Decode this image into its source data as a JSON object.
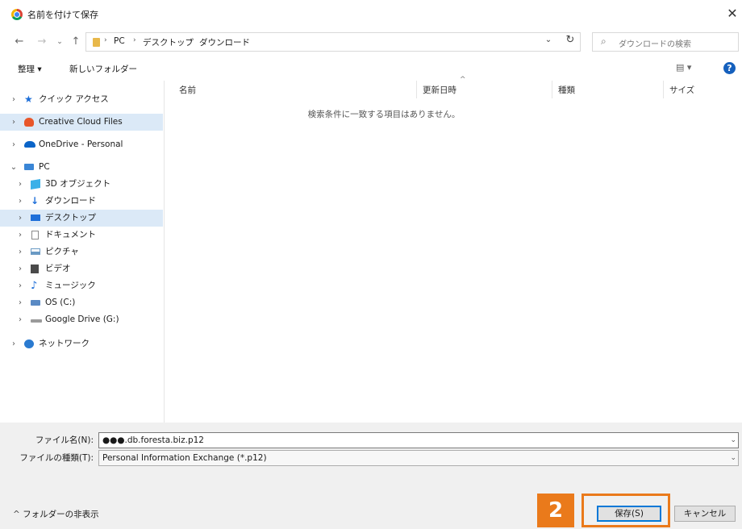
{
  "window": {
    "title": "名前を付けて保存",
    "close_glyph": "✕"
  },
  "nav": {
    "breadcrumbs": [
      "PC",
      "デスクトップ",
      "ダウンロード"
    ],
    "search_placeholder": "ダウンロードの検索"
  },
  "toolbar": {
    "organize_label": "整理 ▾",
    "new_folder_label": "新しいフォルダー",
    "view_label": "▤ ▾",
    "help_label": "?"
  },
  "sidebar": {
    "items": [
      {
        "label": "クイック アクセス",
        "icon": "star-icon",
        "color": "#1e6fd9"
      },
      {
        "label": "Creative Cloud Files",
        "icon": "creative-cloud-icon",
        "color": "#e8562a"
      },
      {
        "label": "OneDrive - Personal",
        "icon": "cloud-icon",
        "color": "#0a64c8"
      },
      {
        "label": "PC",
        "icon": "pc-icon",
        "color": "#3a86d6"
      },
      {
        "label": "3D オブジェクト",
        "icon": "cube-icon",
        "color": "#3ab0e8"
      },
      {
        "label": "ダウンロード",
        "icon": "download-icon",
        "color": "#1e6fd9"
      },
      {
        "label": "デスクトップ",
        "icon": "desktop-icon",
        "color": "#1e6fd9"
      },
      {
        "label": "ドキュメント",
        "icon": "document-icon",
        "color": "#8a8a8a"
      },
      {
        "label": "ピクチャ",
        "icon": "picture-icon",
        "color": "#6a9ac4"
      },
      {
        "label": "ビデオ",
        "icon": "video-icon",
        "color": "#4a4a4a"
      },
      {
        "label": "ミュージック",
        "icon": "music-icon",
        "color": "#1e6fd9"
      },
      {
        "label": "OS (C:)",
        "icon": "drive-icon",
        "color": "#5a8ac4"
      },
      {
        "label": "Google Drive (G:)",
        "icon": "drive-icon",
        "color": "#9a9a9a"
      },
      {
        "label": "ネットワーク",
        "icon": "network-icon",
        "color": "#2a7ad0"
      }
    ]
  },
  "content": {
    "columns": [
      "名前",
      "更新日時",
      "種類",
      "サイズ"
    ],
    "empty_message": "検索条件に一致する項目はありません。"
  },
  "bottom": {
    "filename_label": "ファイル名(N):",
    "filename_value": "●●●.db.foresta.biz.p12",
    "filetype_label": "ファイルの種類(T):",
    "filetype_value": "Personal Information Exchange (*.p12)",
    "hide_folders_label": "フォルダーの非表示",
    "save_label": "保存(S)",
    "cancel_label": "キャンセル",
    "step_badge": "2"
  }
}
